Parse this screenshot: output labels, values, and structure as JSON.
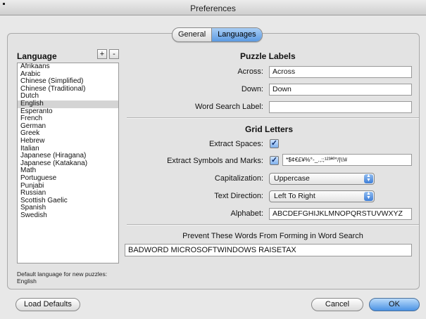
{
  "window": {
    "title": "Preferences"
  },
  "tabs": [
    {
      "label": "General",
      "selected": false
    },
    {
      "label": "Languages",
      "selected": true
    }
  ],
  "language_panel": {
    "heading": "Language",
    "add_label": "+",
    "remove_label": "-",
    "items": [
      "Afrikaans",
      "Arabic",
      "Chinese (Simplified)",
      "Chinese (Traditional)",
      "Dutch",
      "English",
      "Esperanto",
      "French",
      "German",
      "Greek",
      "Hebrew",
      "Italian",
      "Japanese (Hiragana)",
      "Japanese (Katakana)",
      "Math",
      "Portuguese",
      "Punjabi",
      "Russian",
      "Scottish Gaelic",
      "Spanish",
      "Swedish"
    ],
    "selected": "English",
    "default_note": "Default language for new puzzles: English"
  },
  "puzzle_labels": {
    "title": "Puzzle Labels",
    "across_label": "Across:",
    "across_value": "Across",
    "down_label": "Down:",
    "down_value": "Down",
    "word_search_label": "Word Search Label:",
    "word_search_value": ""
  },
  "grid_letters": {
    "title": "Grid Letters",
    "extract_spaces_label": "Extract Spaces:",
    "extract_spaces_checked": true,
    "extract_symbols_label": "Extract Symbols and Marks:",
    "extract_symbols_checked": true,
    "symbols_value": "*$¢€£¥%°-_.,:;¹²³ªº°/|\\!#",
    "capitalization_label": "Capitalization:",
    "capitalization_value": "Uppercase",
    "text_direction_label": "Text Direction:",
    "text_direction_value": "Left To Right",
    "alphabet_label": "Alphabet:",
    "alphabet_value": "ABCDEFGHIJKLMNOPQRSTUVWXYZ"
  },
  "prevent": {
    "label": "Prevent These Words From Forming in Word Search",
    "value": "BADWORD MICROSOFTWINDOWS RAISETAX"
  },
  "buttons": {
    "load_defaults": "Load Defaults",
    "cancel": "Cancel",
    "ok": "OK"
  }
}
